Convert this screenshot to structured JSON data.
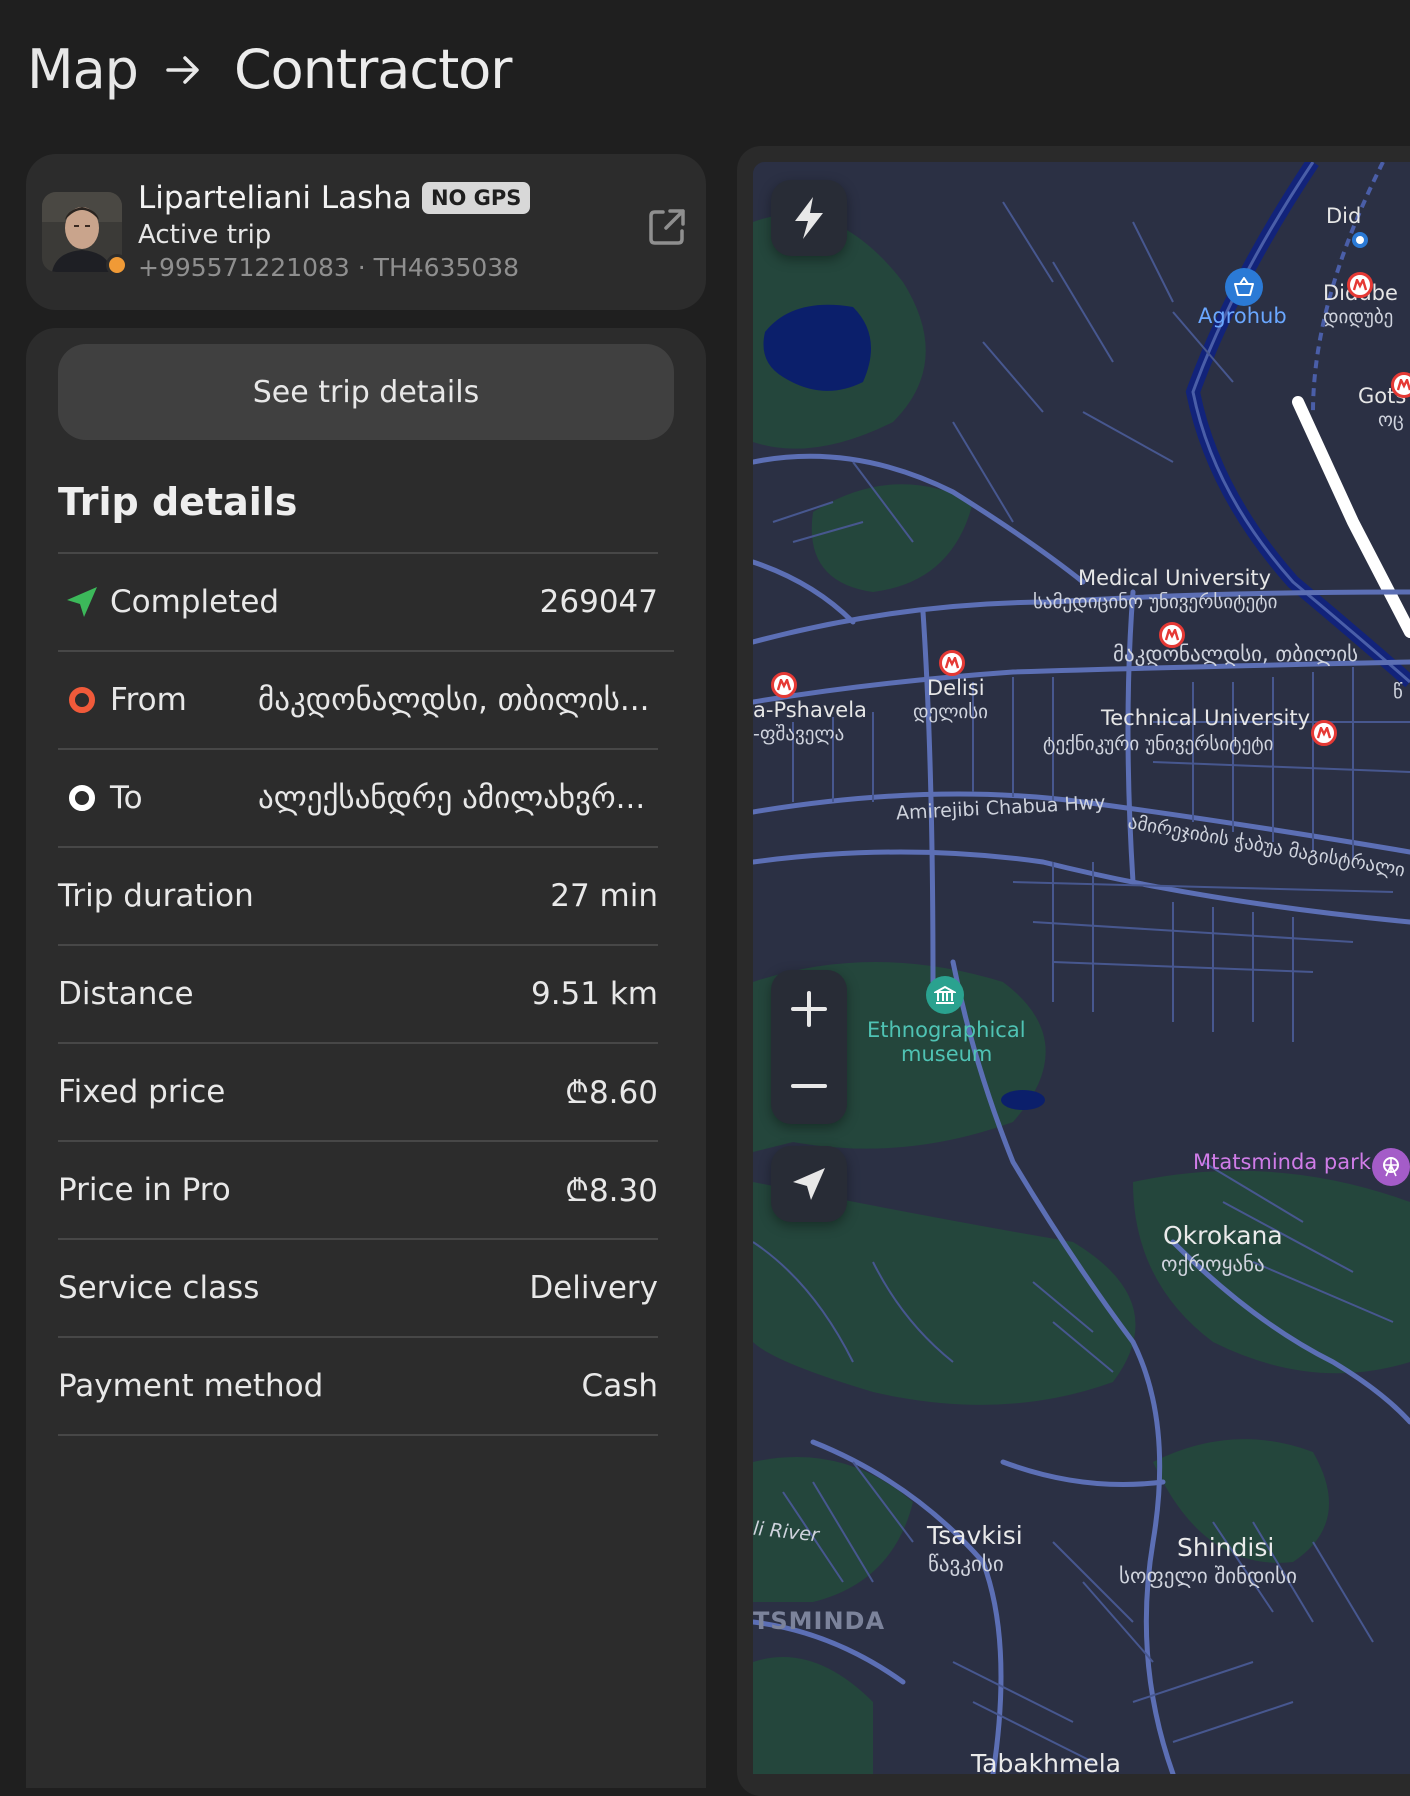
{
  "header": {
    "crumb_parent": "Map",
    "crumb_current": "Contractor"
  },
  "contractor": {
    "name": "Liparteliani Lasha",
    "badge": "NO GPS",
    "status": "Active trip",
    "phone": "+995571221083",
    "id_separator": " · ",
    "vehicle_id": "TH4635038",
    "status_dot_color": "#f09a36"
  },
  "trip": {
    "button_label": "See trip details",
    "section_title": "Trip details",
    "status_label": "Completed",
    "status_value": "269047",
    "from_label": "From",
    "from_value": "მაკდონალდსი, თბილის...",
    "to_label": "To",
    "to_value": "ალექსანდრე ამილახვრ...",
    "rows": [
      {
        "label": "Trip duration",
        "value": "27 min"
      },
      {
        "label": "Distance",
        "value": "9.51 km"
      },
      {
        "label": "Fixed price",
        "value": "₾8.60"
      },
      {
        "label": "Price in Pro",
        "value": "₾8.30"
      },
      {
        "label": "Service class",
        "value": "Delivery"
      },
      {
        "label": "Payment method",
        "value": "Cash"
      }
    ]
  },
  "map": {
    "labels": {
      "did": "Did",
      "didube": "Didube",
      "didube_geo": "დიდუბე",
      "agrohub": "Agrohub",
      "gots": "Gots",
      "gots_geo": "ოც",
      "medical_university": "Medical University",
      "medical_university_geo": "სამედიცინო უნივერსიტეტი",
      "mcdonalds_geo": "მაკდონალდსი, თბილის",
      "geo_edge": "წ",
      "delisi": "Delisi",
      "delisi_geo": "დელისი",
      "pshavela": "a-Pshavela",
      "pshavela_geo": "-ფშაველა",
      "technical_university": "Technical University",
      "technical_university_geo": "ტექნიკური უნივერსიტეტი",
      "amirejibi_hwy": "Amirejibi Chabua Hwy",
      "amirejibi_geo": "ამირეჯიბის ჭაბუა მაგისტრალი",
      "ethnographical": "Ethnographical",
      "museum": "museum",
      "mtatsminda_park": "Mtatsminda park",
      "okrokana": "Okrokana",
      "okrokana_geo": "ოქროყანა",
      "river": "li River",
      "tsavkisi": "Tsavkisi",
      "tsavkisi_geo": "წავკისი",
      "shindisi": "Shindisi",
      "shindisi_geo": "სოფელი შინდისი",
      "tsminda": "TSMINDA",
      "tabakhmela": "Tabakhmela"
    },
    "colors": {
      "land": "#2b3044",
      "park": "#24463c",
      "road": "#5c6fb5",
      "major_road": "#12237a",
      "water": "#0b1f6b",
      "metro": "#e53935"
    }
  }
}
